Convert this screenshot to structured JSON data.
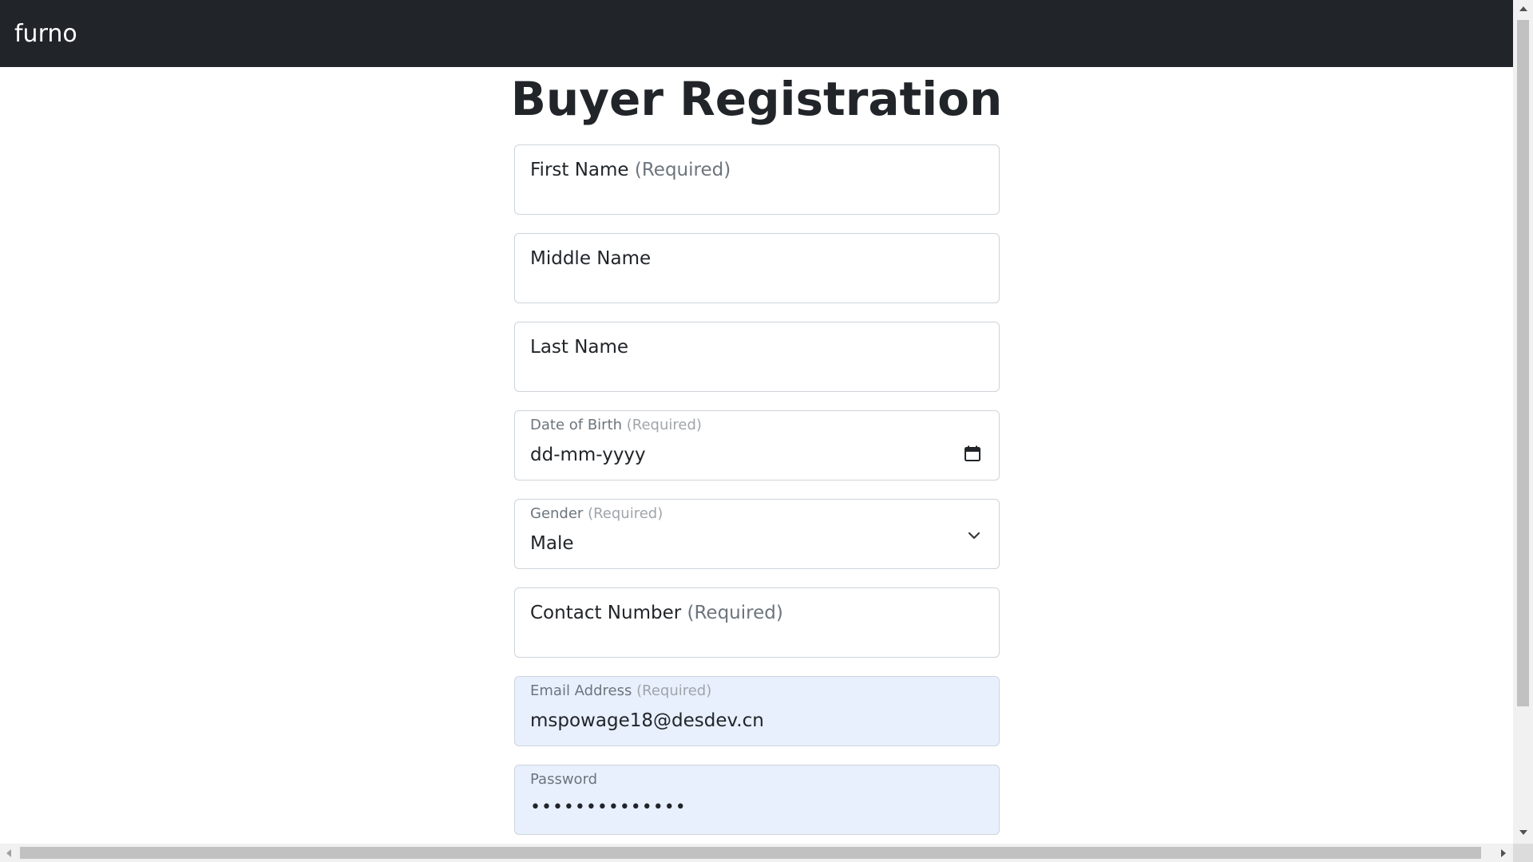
{
  "navbar": {
    "brand": "furno"
  },
  "page": {
    "title": "Buyer Registration"
  },
  "form": {
    "required_tag": "(Required)",
    "first_name": {
      "label": "First Name",
      "value": ""
    },
    "middle_name": {
      "label": "Middle Name",
      "value": ""
    },
    "last_name": {
      "label": "Last Name",
      "value": ""
    },
    "dob": {
      "label": "Date of Birth",
      "value": "dd-mm-yyyy",
      "icon": "calendar-icon"
    },
    "gender": {
      "label": "Gender",
      "value": "Male",
      "icon": "chevron-down-icon"
    },
    "contact": {
      "label": "Contact Number",
      "value": ""
    },
    "email": {
      "label": "Email Address",
      "value": "mspowage18@desdev.cn"
    },
    "password": {
      "label": "Password",
      "value": "••••••••••••••"
    }
  },
  "colors": {
    "navbar_bg": "#212529",
    "autofill_bg": "#e8f0fe",
    "border": "#ced4da"
  }
}
